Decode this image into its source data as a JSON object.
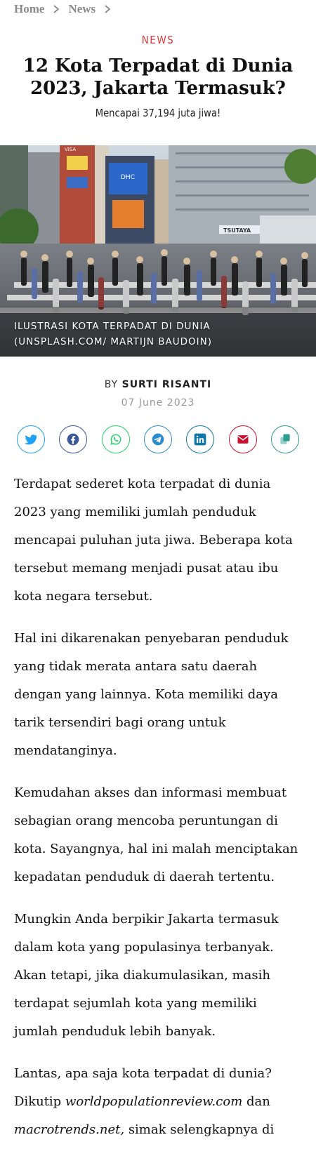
{
  "breadcrumb": {
    "home": "Home",
    "news": "News"
  },
  "category": "NEWS",
  "title": "12 Kota Terpadat di Dunia 2023, Jakarta Termasuk?",
  "subtitle": "Mencapai 37,194 juta jiwa!",
  "hero": {
    "caption": "ILUSTRASI KOTA TERPADAT DI DUNIA (UNSPLASH.COM/ MARTIJN BAUDOIN)",
    "signs": [
      "DHC",
      "TSUTAYA",
      "VISA"
    ]
  },
  "byline": {
    "prefix": "BY",
    "author": "SURTI RISANTI",
    "date": "07 June 2023"
  },
  "share": [
    {
      "name": "twitter",
      "icon": "twitter-icon",
      "color": "#1da1f2"
    },
    {
      "name": "facebook",
      "icon": "facebook-icon",
      "color": "#3b5998"
    },
    {
      "name": "whatsapp",
      "icon": "whatsapp-icon",
      "color": "#25d366"
    },
    {
      "name": "telegram",
      "icon": "telegram-icon",
      "color": "#2b8bd1"
    },
    {
      "name": "linkedin",
      "icon": "linkedin-icon",
      "color": "#0e76a8"
    },
    {
      "name": "email",
      "icon": "email-icon",
      "color": "#c8102e"
    },
    {
      "name": "copy",
      "icon": "copy-icon",
      "color": "#2a9d8f"
    }
  ],
  "article": {
    "p1": "Terdapat sederet kota terpadat di dunia 2023 yang memiliki jumlah penduduk mencapai puluhan juta jiwa. Beberapa kota tersebut memang menjadi pusat atau ibu kota negara tersebut.",
    "p2": "Hal ini dikarenakan penyebaran penduduk yang tidak merata antara satu daerah dengan yang lainnya. Kota memiliki daya tarik tersendiri bagi orang untuk mendatanginya.",
    "p3": "Kemudahan akses dan informasi membuat sebagian orang mencoba peruntungan di kota. Sayangnya, hal ini malah menciptakan kepadatan penduduk di daerah tertentu.",
    "p4": "Mungkin Anda berpikir Jakarta termasuk dalam kota yang populasinya terbanyak. Akan tetapi, jika diakumulasikan, masih terdapat sejumlah kota yang memiliki jumlah penduduk lebih banyak.",
    "p5_a": "Lantas, apa saja kota terpadat di dunia? Dikutip ",
    "p5_link1": "worldpopulationreview.com",
    "p5_b": " dan ",
    "p5_link2": "macrotrends.net,",
    "p5_c": " simak selengkapnya di bawah ini!"
  }
}
